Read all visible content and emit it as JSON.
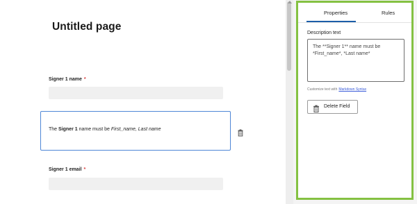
{
  "canvas": {
    "page_title": "Untitled page",
    "fields": [
      {
        "label": "Signer 1 name",
        "required_mark": "*"
      },
      {
        "label": "Signer 1 email",
        "required_mark": "*"
      }
    ],
    "description_block": {
      "prefix": "The ",
      "bold": "Signer 1",
      "middle": " name must be ",
      "italic": "First_name, Last name"
    },
    "block_action_icon": "trash-icon"
  },
  "panel": {
    "tabs": [
      {
        "label": "Properties",
        "active": true
      },
      {
        "label": "Rules",
        "active": false
      }
    ],
    "description_label": "Description text",
    "description_value": "The **Signer 1** name must be *First_name*, *Last name*",
    "hint_text": "Customize text with",
    "hint_link": "Markdown Syntax",
    "delete_button": {
      "label": "Delete Field",
      "icon": "trash-icon"
    }
  },
  "colors": {
    "panel_highlight": "#84c142",
    "selected_block_border": "#4e86d6",
    "tab_underline": "#1c5ea8",
    "required": "#d83a3a",
    "link": "#3a5bd9"
  }
}
